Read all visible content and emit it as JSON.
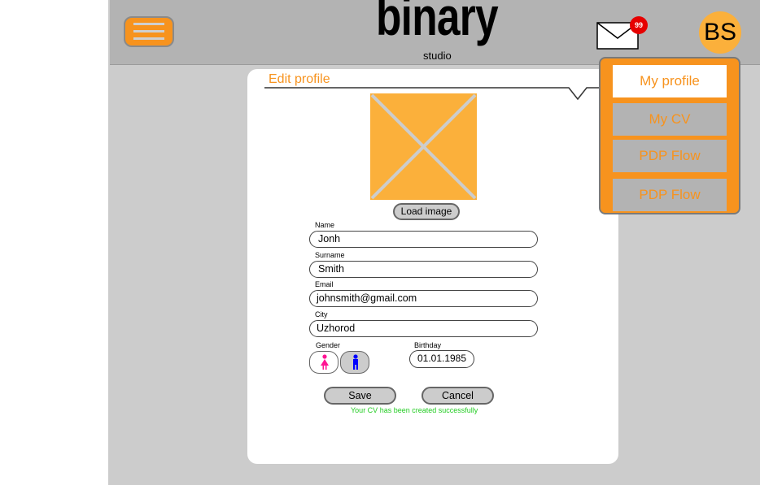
{
  "header": {
    "logo_word": "binary",
    "logo_sub": "studio",
    "mail_badge": "99",
    "avatar_initials": "BS"
  },
  "menu": {
    "items": [
      {
        "label": "My profile"
      },
      {
        "label": "My CV"
      },
      {
        "label": "PDP Flow"
      },
      {
        "label": "PDP Flow"
      }
    ]
  },
  "profile": {
    "title": "Edit profile",
    "load_image_label": "Load image",
    "name_label": "Name",
    "name_value": "Jonh",
    "surname_label": "Surname",
    "surname_value": "Smith",
    "email_label": "Email",
    "email_value": "johnsmith@gmail.com",
    "city_label": "City",
    "city_value": "Uzhorod",
    "gender_label": "Gender",
    "birthday_label": "Birthday",
    "birthday_value": "01.01.1985",
    "save_label": "Save",
    "cancel_label": "Cancel",
    "status_text": "Your CV has been created successfully"
  },
  "colors": {
    "accent": "#f7931e",
    "placeholder": "#fbb03b",
    "badge": "#e60000",
    "success": "#22cc22",
    "female_icon": "#ff1493",
    "male_icon": "#0000ff"
  },
  "icons": [
    "menu-icon",
    "mail-icon",
    "female-icon",
    "male-icon"
  ]
}
